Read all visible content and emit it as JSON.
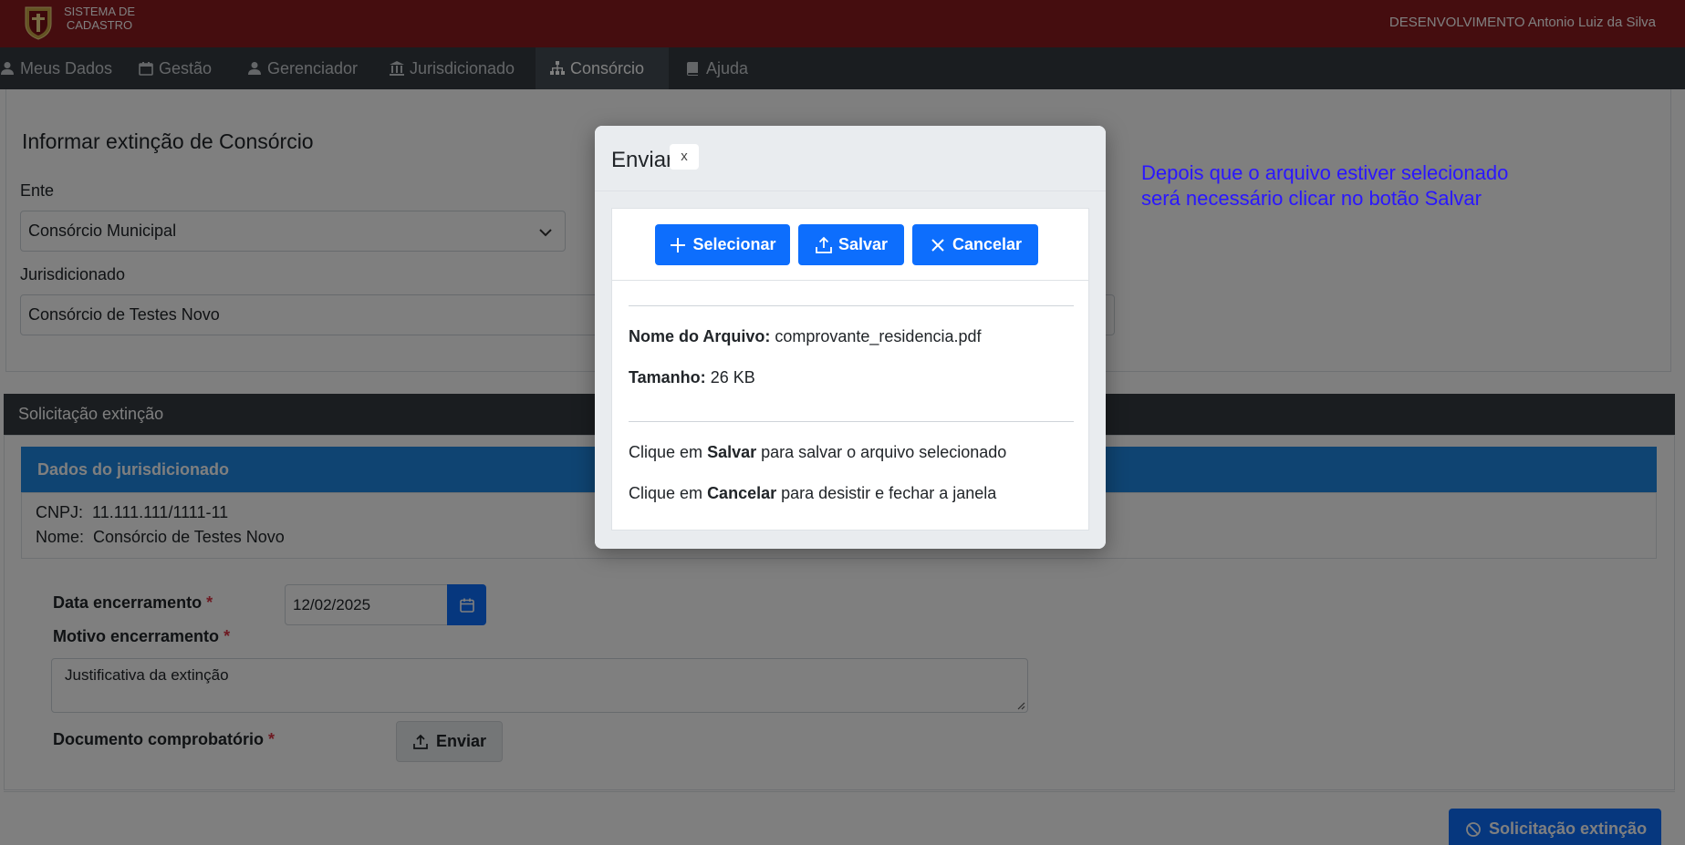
{
  "header": {
    "brand_line1": "SISTEMA DE",
    "brand_line2": "CADASTRO",
    "user_info": "DESENVOLVIMENTO Antonio Luiz da Silva"
  },
  "nav": {
    "items": [
      {
        "label": "Meus Dados",
        "icon": "user-icon"
      },
      {
        "label": "Gestão",
        "icon": "calendar-icon"
      },
      {
        "label": "Gerenciador",
        "icon": "user-icon"
      },
      {
        "label": "Jurisdicionado",
        "icon": "institution-icon"
      },
      {
        "label": "Consórcio",
        "icon": "sitemap-icon"
      },
      {
        "label": "Ajuda",
        "icon": "book-icon"
      }
    ],
    "active": "Consórcio"
  },
  "form_top": {
    "title": "Informar extinção de Consórcio",
    "ente_label": "Ente",
    "ente_value": "Consórcio Municipal",
    "jurisdicionado_label": "Jurisdicionado",
    "jurisdicionado_value": "Consórcio de Testes Novo"
  },
  "solicitacao": {
    "header": "Solicitação extinção",
    "dados_header": "Dados do jurisdicionado",
    "cnpj_label": "CNPJ:",
    "cnpj_value": "11.111.111/1111-11",
    "nome_label": "Nome:",
    "nome_value": "Consórcio de Testes Novo",
    "data_label": "Data encerramento",
    "data_value": "12/02/2025",
    "motivo_label": "Motivo encerramento",
    "motivo_value": "Justificativa da extinção",
    "documento_label": "Documento comprobatório",
    "required_mark": "*",
    "enviar_label": "Enviar",
    "submit_label": "Solicitação extinção"
  },
  "note": {
    "line1": "Depois que o arquivo estiver selecionado",
    "line2": "será necessário clicar no botão Salvar"
  },
  "modal": {
    "title": "Enviar",
    "close_label": "x",
    "selecionar_label": "Selecionar",
    "salvar_label": "Salvar",
    "cancelar_label": "Cancelar",
    "nome_arquivo_label": "Nome do Arquivo:",
    "nome_arquivo_value": "comprovante_residencia.pdf",
    "tamanho_label": "Tamanho:",
    "tamanho_value": "26 KB",
    "hint1_pre": "Clique em",
    "hint1_bold": "Salvar",
    "hint1_post": "para salvar o arquivo selecionado",
    "hint2_pre": "Clique em",
    "hint2_bold": "Cancelar",
    "hint2_post": "para desistir e fechar a janela"
  },
  "colors": {
    "topbar": "#8b1a1f",
    "navbar": "#343a40",
    "primary": "#0d6efd",
    "note_text": "#2a16ff"
  }
}
